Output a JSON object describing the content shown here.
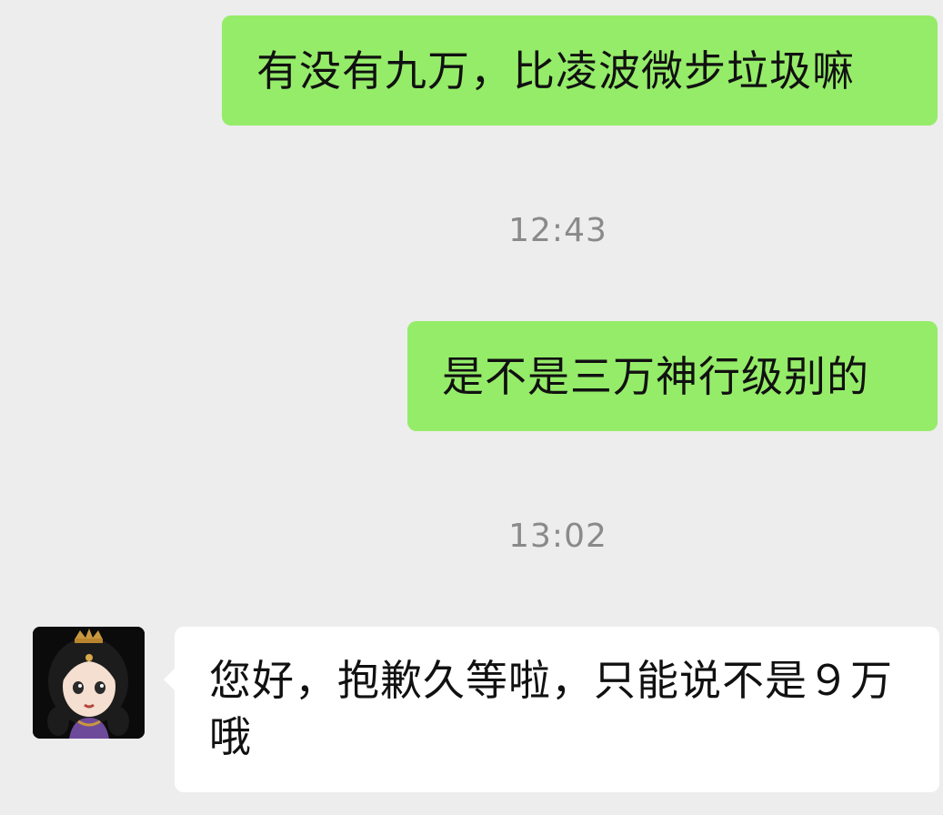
{
  "messages": [
    {
      "direction": "sent",
      "text": "有没有九万，比凌波微步垃圾嘛"
    },
    {
      "direction": "sent",
      "text": "是不是三万神行级别的"
    },
    {
      "direction": "received",
      "text": "您好，抱歉久等啦，只能说不是９万哦"
    }
  ],
  "timestamps": [
    "12:43",
    "13:02"
  ],
  "colors": {
    "background": "#ededed",
    "sent_bubble": "#95ec69",
    "received_bubble": "#ffffff",
    "timestamp_text": "#8a8a8a",
    "message_text": "#111111"
  },
  "icons": {
    "contact_avatar": "avatar-anime-girl-icon"
  }
}
